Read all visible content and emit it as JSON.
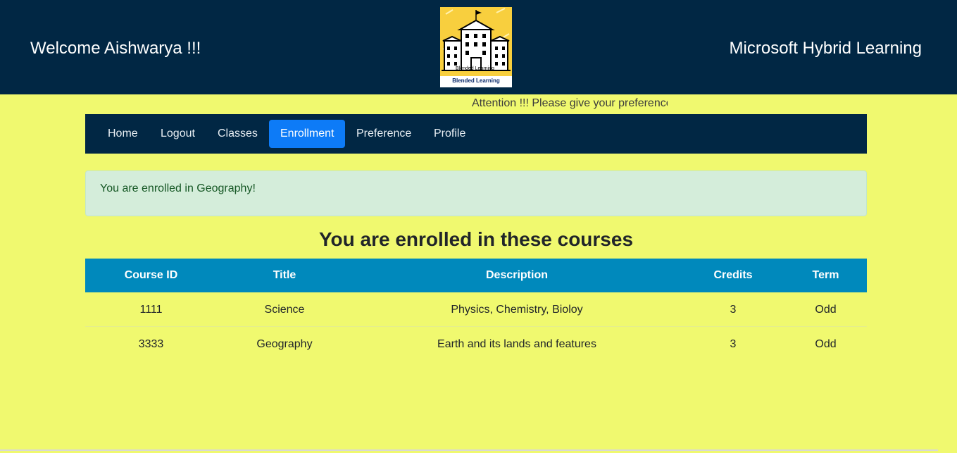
{
  "header": {
    "welcome": "Welcome Aishwarya !!!",
    "brand": "Microsoft Hybrid Learning",
    "logo_caption": "Blended Learning",
    "logo_small_text": "Blended Learning",
    "logo_icon": "school-building-icon"
  },
  "marquee": "Attention !!! Please give your preference",
  "nav": {
    "items": [
      {
        "label": "Home"
      },
      {
        "label": "Logout"
      },
      {
        "label": "Classes"
      },
      {
        "label": "Enrollment"
      },
      {
        "label": "Preference"
      },
      {
        "label": "Profile"
      }
    ],
    "active": "Enrollment"
  },
  "alert": {
    "message": "You are enrolled in Geography!"
  },
  "section_title": "You are enrolled in these courses",
  "table": {
    "headers": [
      "Course ID",
      "Title",
      "Description",
      "Credits",
      "Term"
    ],
    "rows": [
      [
        "1111",
        "Science",
        "Physics, Chemistry, Bioloy",
        "3",
        "Odd"
      ],
      [
        "3333",
        "Geography",
        "Earth and its lands and features",
        "3",
        "Odd"
      ]
    ]
  },
  "colors": {
    "page_bg": "#f0f96f",
    "header_bg": "#012744",
    "active_nav": "#0d7bf7",
    "table_header": "#0089bc",
    "alert_bg": "#d4edda",
    "alert_text": "#155724"
  }
}
